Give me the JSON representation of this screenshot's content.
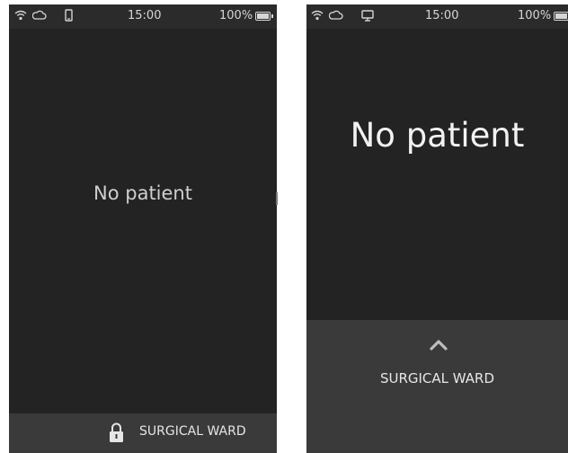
{
  "left_screen": {
    "status_bar": {
      "icons": [
        "wifi-icon",
        "cloud-icon",
        "phone-icon"
      ],
      "time": "15:00",
      "battery": "100%"
    },
    "main_text": "No patient",
    "bottom_bar": {
      "icon": "lock-icon",
      "ward": "SURGICAL WARD"
    }
  },
  "right_screen": {
    "status_bar": {
      "icons": [
        "wifi-icon",
        "cloud-icon",
        "monitor-icon"
      ],
      "time": "15:00",
      "battery": "100%"
    },
    "main_text": "No patient",
    "bottom_panel": {
      "icon": "chevron-up-icon",
      "ward": "SURGICAL WARD"
    }
  },
  "colors": {
    "screen_bg": "#232323",
    "status_bar_bg": "#2b2b2b",
    "bottom_bar_bg": "#3a3a3a",
    "text": "#cfcfcf"
  }
}
